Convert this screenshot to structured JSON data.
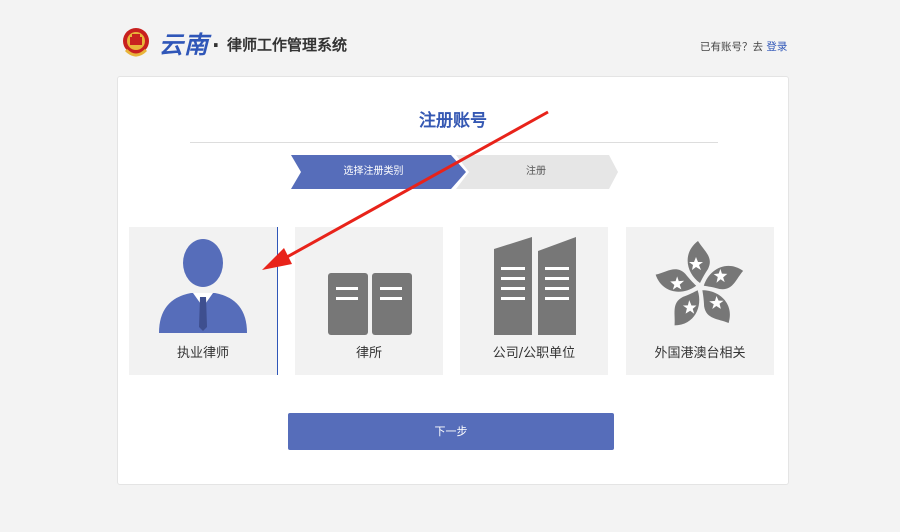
{
  "header": {
    "logo_text": "云南",
    "logo_dot": "·",
    "system_name": "律师工作管理系统",
    "login_prompt": "已有账号？去 ",
    "login_link": "登录"
  },
  "page": {
    "title": "注册账号"
  },
  "steps": [
    {
      "label": "选择注册类别",
      "active": true
    },
    {
      "label": "注册",
      "active": false
    }
  ],
  "options": [
    {
      "label": "执业律师",
      "icon": "lawyer-person-icon",
      "selected": true
    },
    {
      "label": "律所",
      "icon": "law-firm-building-icon",
      "selected": false
    },
    {
      "label": "公司/公职单位",
      "icon": "office-building-icon",
      "selected": false
    },
    {
      "label": "外国港澳台相关",
      "icon": "bauhinia-flower-icon",
      "selected": false
    }
  ],
  "next_button": "下一步",
  "colors": {
    "accent": "#566dba",
    "brand_blue": "#2f56b8",
    "icon_gray": "#777777",
    "annotation_red": "#e8231a"
  }
}
